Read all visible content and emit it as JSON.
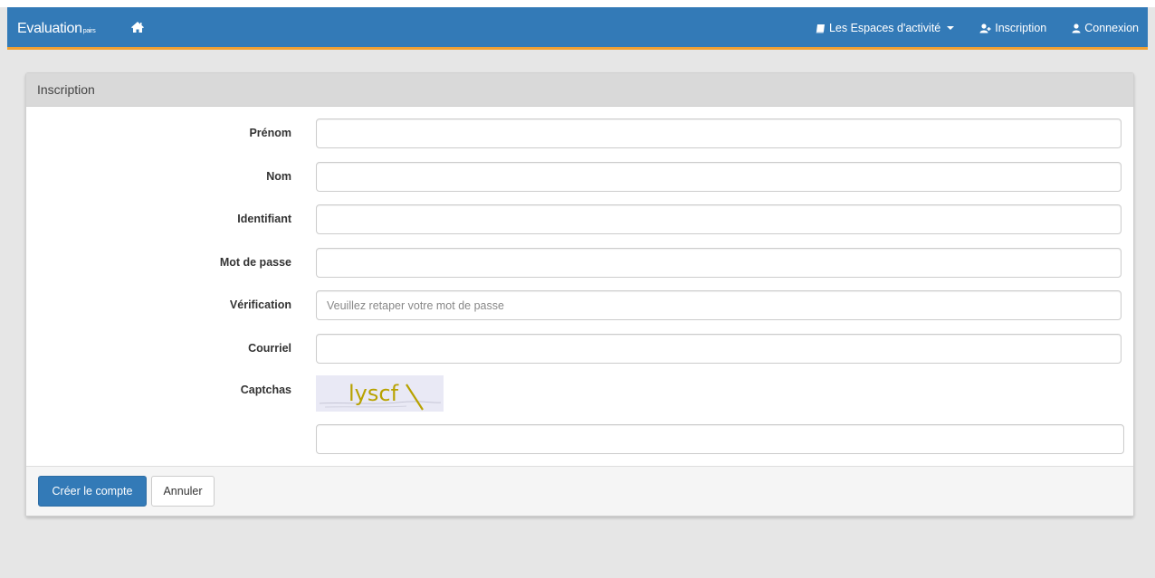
{
  "navbar": {
    "brand": "Evaluation",
    "brand_sub": "pairs",
    "spaces_label": "Les Espaces d'activité",
    "register_label": "Inscription",
    "login_label": "Connexion"
  },
  "panel": {
    "title": "Inscription"
  },
  "form": {
    "fields": [
      {
        "label": "Prénom",
        "value": "",
        "placeholder": ""
      },
      {
        "label": "Nom",
        "value": "",
        "placeholder": ""
      },
      {
        "label": "Identifiant",
        "value": "",
        "placeholder": ""
      },
      {
        "label": "Mot de passe",
        "value": "",
        "placeholder": ""
      },
      {
        "label": "Vérification",
        "value": "",
        "placeholder": "Veuillez retaper votre mot de passe"
      },
      {
        "label": "Courriel",
        "value": "",
        "placeholder": ""
      }
    ],
    "captcha_label": "Captchas",
    "captcha_text": "lyscf",
    "captcha_answer": ""
  },
  "actions": {
    "submit_label": "Créer le compte",
    "cancel_label": "Annuler"
  },
  "colors": {
    "navbar": "#337ab7",
    "accent": "#f0a033",
    "captcha_text": "#b8a200"
  }
}
